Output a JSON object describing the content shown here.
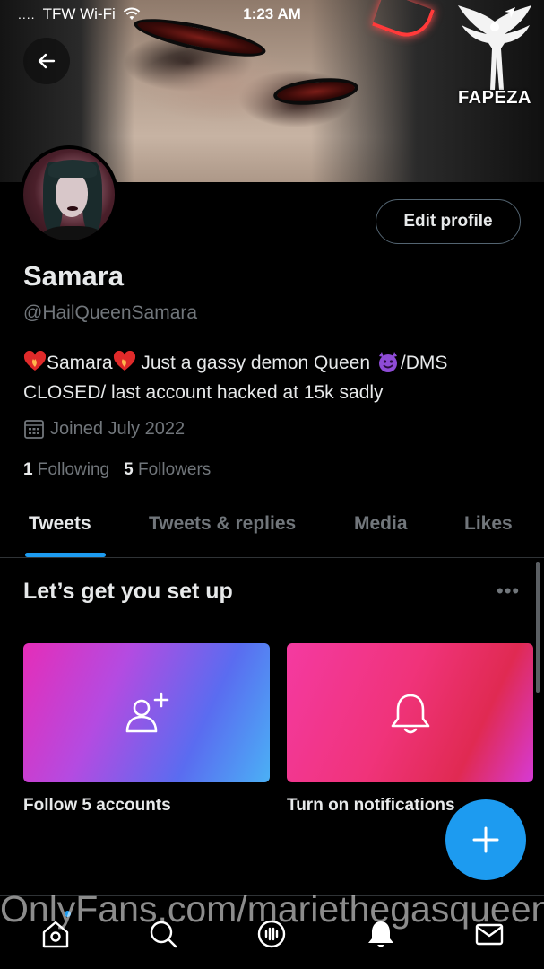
{
  "status_bar": {
    "carrier": "TFW Wi-Fi",
    "signal_dots": "....",
    "time": "1:23 AM"
  },
  "watermark_top": {
    "label": "FAPEZA"
  },
  "profile": {
    "name": "Samara",
    "handle": "@HailQueenSamara",
    "bio_line1": "Samara",
    "bio_line1_rest": " Just a gassy demon Queen ",
    "bio_line1_end": "/DMS",
    "bio_line2": "CLOSED/ last account hacked at 15k sadly",
    "joined": "Joined July 2022",
    "following_count": "1",
    "following_label": "Following",
    "followers_count": "5",
    "followers_label": "Followers",
    "edit_profile_label": "Edit profile"
  },
  "tabs": [
    {
      "label": "Tweets",
      "active": true
    },
    {
      "label": "Tweets & replies",
      "active": false
    },
    {
      "label": "Media",
      "active": false
    },
    {
      "label": "Likes",
      "active": false
    }
  ],
  "setup": {
    "title": "Let’s get you set up",
    "more": "•••",
    "cards": [
      {
        "label": "Follow 5 accounts",
        "icon": "add-user-icon"
      },
      {
        "label": "Turn on notifications",
        "icon": "bell-icon"
      }
    ]
  },
  "bottom_nav": [
    {
      "icon": "home-icon"
    },
    {
      "icon": "search-icon"
    },
    {
      "icon": "spaces-icon"
    },
    {
      "icon": "notifications-icon"
    },
    {
      "icon": "messages-icon"
    }
  ],
  "watermark_bottom": {
    "text": "OnlyFans.com/mariethegasqueen"
  },
  "colors": {
    "accent": "#1d9bf0",
    "text_primary": "#e7e9ea",
    "text_secondary": "#71767b",
    "divider": "#2f3336"
  }
}
